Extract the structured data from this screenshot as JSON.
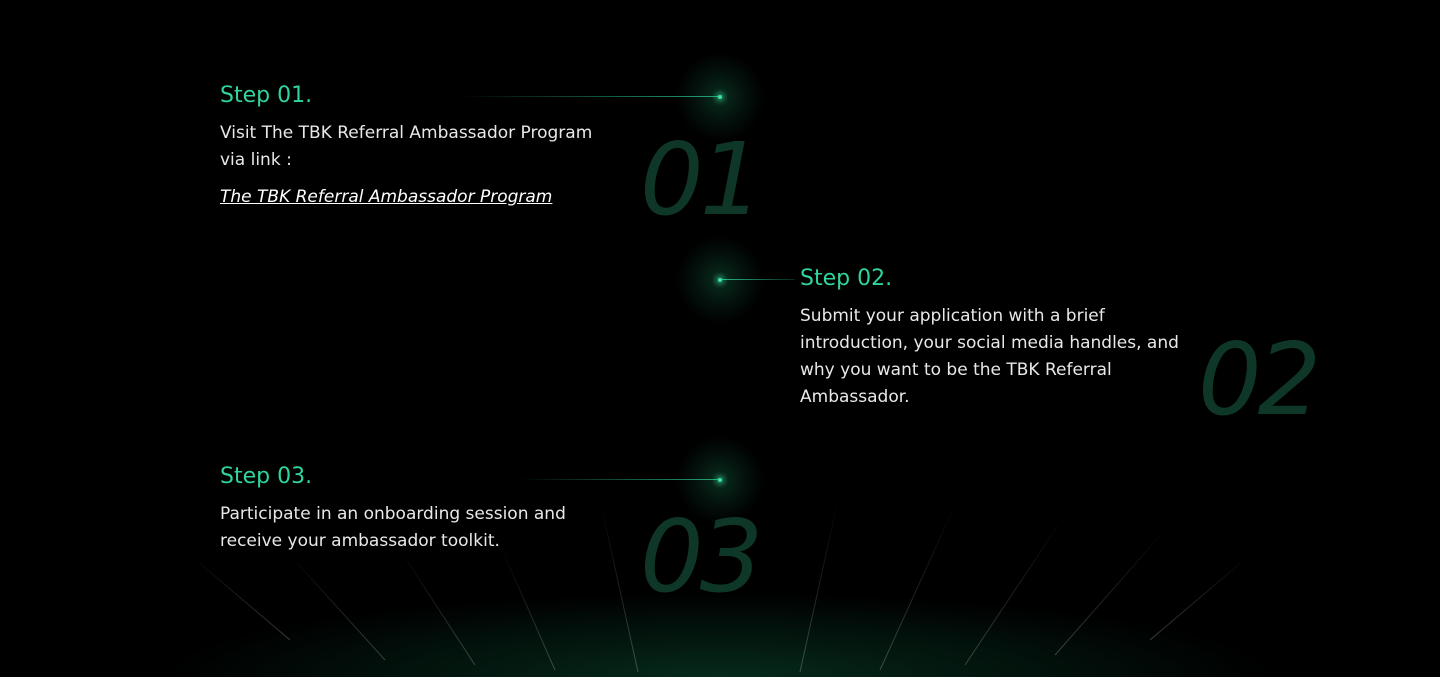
{
  "steps": [
    {
      "title": "Step 01.",
      "description": "Visit The TBK Referral Ambassador Program via link :",
      "link_text": "The TBK Referral Ambassador Program",
      "number": "01"
    },
    {
      "title": "Step 02.",
      "description": "Submit your application with a brief introduction, your social media handles, and why you want to be the TBK Referral Ambassador.",
      "number": "02"
    },
    {
      "title": "Step 03.",
      "description": "Participate in an onboarding session and receive your ambassador toolkit.",
      "number": "03"
    }
  ],
  "colors": {
    "background": "#000000",
    "accent": "#2fd59a",
    "text": "#e8e8e8",
    "number": "#0f3a2a"
  }
}
